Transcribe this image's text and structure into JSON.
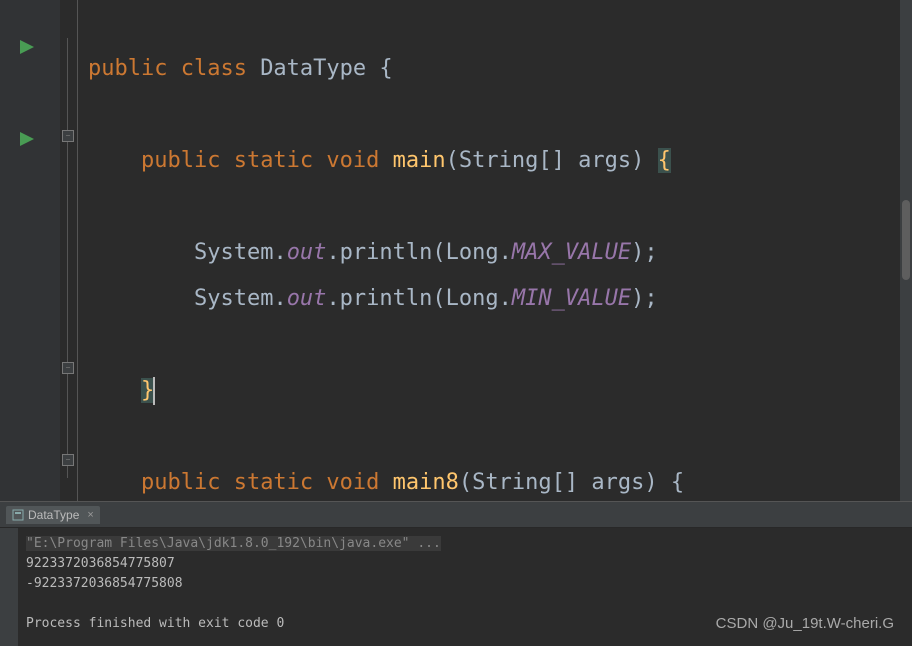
{
  "code": {
    "class_kw": "public class ",
    "class_name": "DataType",
    "class_open": " {",
    "method_sig_kw": "public static void ",
    "method_name": "main",
    "method_params_open": "(",
    "param_type": "String",
    "param_brackets": "[] ",
    "param_name": "args",
    "method_params_close": ") ",
    "method_brace_open": "{",
    "stmt1_obj": "System.",
    "stmt1_field": "out",
    "stmt1_call": ".println(Long.",
    "stmt1_const": "MAX_VALUE",
    "stmt1_end": ");",
    "stmt2_obj": "System.",
    "stmt2_field": "out",
    "stmt2_call": ".println(Long.",
    "stmt2_const": "MIN_VALUE",
    "stmt2_end": ");",
    "method_brace_close": "}",
    "method2_sig_kw": "public static void ",
    "method2_name": "main8",
    "method2_params_open": "(",
    "method2_param_type": "String",
    "method2_param_brackets": "[] ",
    "method2_param_name": "args",
    "method2_params_close": ") {"
  },
  "console": {
    "tab_name": "DataType",
    "cmd": "\"E:\\Program Files\\Java\\jdk1.8.0_192\\bin\\java.exe\" ...",
    "out1": "9223372036854775807",
    "out2": "-9223372036854775808",
    "exit": "Process finished with exit code 0"
  },
  "watermark": "CSDN @Ju_19t.W-cheri.G"
}
